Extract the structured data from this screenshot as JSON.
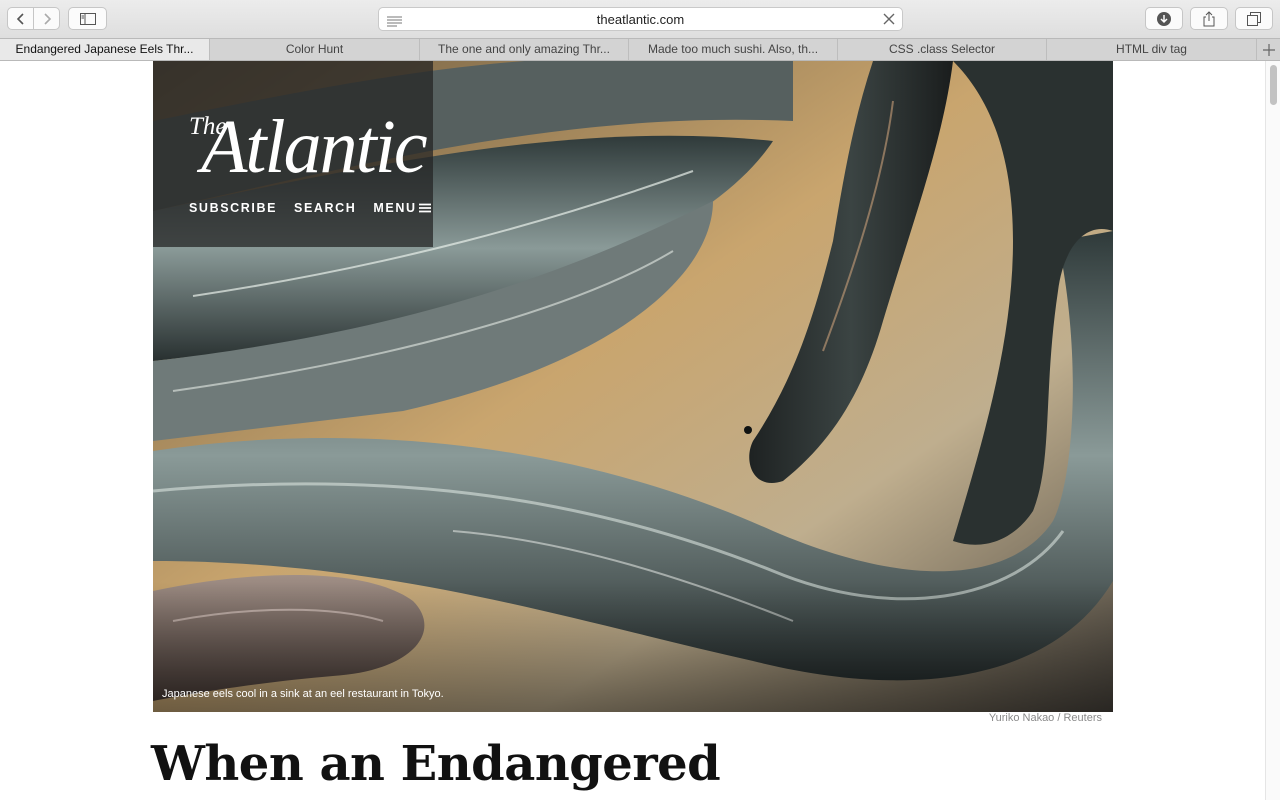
{
  "browser": {
    "address": "theatlantic.com",
    "tabs": [
      {
        "label": "Endangered Japanese Eels Thr..."
      },
      {
        "label": "Color Hunt"
      },
      {
        "label": "The one and only amazing Thr..."
      },
      {
        "label": "Made too much sushi. Also, th..."
      },
      {
        "label": "CSS .class Selector"
      },
      {
        "label": "HTML div tag"
      }
    ]
  },
  "site": {
    "logo_the": "The",
    "logo_main": "Atlantic",
    "nav": {
      "subscribe": "SUBSCRIBE",
      "search": "SEARCH",
      "menu": "MENU"
    }
  },
  "article": {
    "caption": "Japanese eels cool in a sink at an eel restaurant in Tokyo.",
    "credit": "Yuriko Nakao / Reuters",
    "headline": "When an Endangered"
  }
}
